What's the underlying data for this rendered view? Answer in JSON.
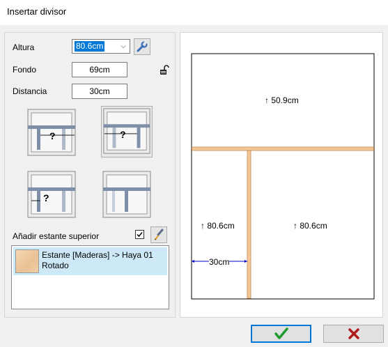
{
  "window": {
    "title": "Insertar divisor"
  },
  "form": {
    "altura_label": "Altura",
    "altura_value": "80.6cm",
    "fondo_label": "Fondo",
    "fondo_value": "69cm",
    "distancia_label": "Distancia",
    "distancia_value": "30cm"
  },
  "options": [
    {
      "name": "divider-option-1",
      "selected": false
    },
    {
      "name": "divider-option-2",
      "selected": true
    },
    {
      "name": "divider-option-3",
      "selected": false
    },
    {
      "name": "divider-option-4",
      "selected": false
    }
  ],
  "top_shelf": {
    "label": "Añadir estante superior",
    "checked": true
  },
  "materials": [
    {
      "line1": "Estante [Maderas] -> Haya 01",
      "line2": "Rotado",
      "selected": true
    }
  ],
  "preview": {
    "top_height": "↑ 50.9cm",
    "left_height": "↑ 80.6cm",
    "right_height": "↑ 80.6cm",
    "distance": "30cm"
  },
  "buttons": {
    "ok_icon": "checkmark-icon",
    "cancel_icon": "x-icon"
  },
  "colors": {
    "accent": "#0078d7",
    "wood": "#f2c79a",
    "ok_green": "#1e9a2e",
    "cancel_red": "#b01c1c"
  }
}
